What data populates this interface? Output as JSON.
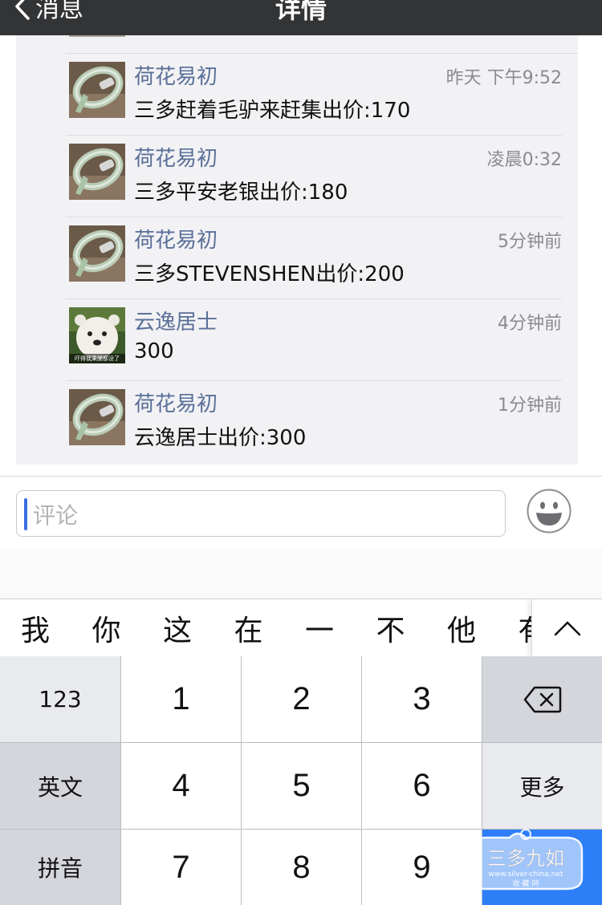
{
  "nav": {
    "back_label": "消息",
    "title": "详情"
  },
  "comments": [
    {
      "name": "荷花易初",
      "time": "昨天 下午9:52",
      "text": "三多赶着毛驴来赶集出价:170"
    },
    {
      "name": "荷花易初",
      "time": "凌晨0:32",
      "text": "三多平安老银出价:180"
    },
    {
      "name": "荷花易初",
      "time": "5分钟前",
      "text": "三多STEVENSHEN出价:200"
    },
    {
      "name": "云逸居士",
      "time": "4分钟前",
      "text": "300",
      "avatar_caption": "吓得我果脯都没了"
    },
    {
      "name": "荷花易初",
      "time": "1分钟前",
      "text": "云逸居士出价:300"
    }
  ],
  "input": {
    "placeholder": "评论"
  },
  "candidates": [
    "我",
    "你",
    "这",
    "在",
    "一",
    "不",
    "他",
    "有"
  ],
  "keyboard": {
    "mode_123": "123",
    "mode_en": "英文",
    "mode_pinyin": "拼音",
    "more": "更多",
    "digits": [
      "1",
      "2",
      "3",
      "4",
      "5",
      "6",
      "7",
      "8",
      "9"
    ]
  },
  "watermark": {
    "title": "三多九如",
    "url": "www.silver-china.net",
    "sub": "收·藏·网"
  },
  "colors": {
    "nav_bg": "#333436",
    "name": "#5a6f98",
    "enter_key": "#2d7ef7",
    "cursor": "#3a6fe0"
  }
}
